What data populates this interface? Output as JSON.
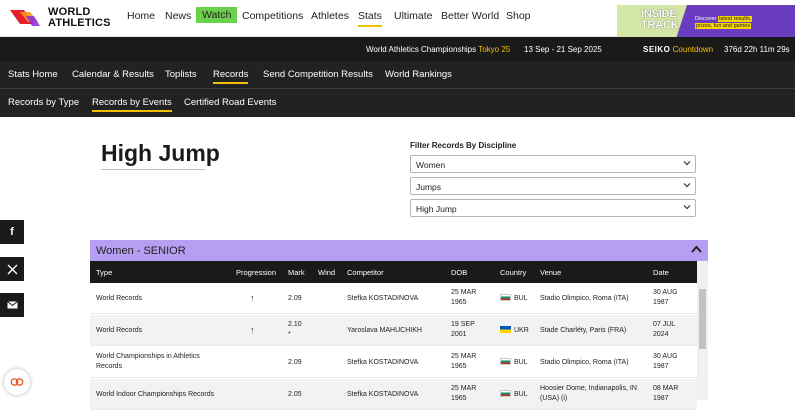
{
  "brand": {
    "name_line1": "WORLD",
    "name_line2": "ATHLETICS"
  },
  "topnav": {
    "items": [
      {
        "label": "Home"
      },
      {
        "label": "News"
      },
      {
        "label": "Watch"
      },
      {
        "label": "Competitions"
      },
      {
        "label": "Athletes"
      },
      {
        "label": "Stats"
      },
      {
        "label": "Ultimate"
      },
      {
        "label": "Better World"
      },
      {
        "label": "Shop"
      }
    ],
    "active": "Stats"
  },
  "promo": {
    "title_line1": "INSIDE",
    "title_line2": "TRACK",
    "text_prefix": "Discover",
    "text_highlight1": "latest results,",
    "text_highlight2": "prizes, fun and games"
  },
  "champbar": {
    "event": "World Athletics Championships",
    "city": "Tokyo 25",
    "dates": "13 Sep - 21 Sep 2025",
    "sponsor": "SEIKO",
    "countdown_label": "Countdown",
    "countdown": "376d 22h 11m 29s"
  },
  "statsnav": {
    "items": [
      {
        "label": "Stats Home"
      },
      {
        "label": "Calendar & Results"
      },
      {
        "label": "Toplists"
      },
      {
        "label": "Records"
      },
      {
        "label": "Send Competition Results"
      },
      {
        "label": "World Rankings"
      }
    ],
    "active": "Records"
  },
  "subnav": {
    "items": [
      {
        "label": "Records by Type"
      },
      {
        "label": "Records by Events"
      },
      {
        "label": "Certified Road Events"
      }
    ],
    "active": "Records by Events"
  },
  "page": {
    "title": "High Jump"
  },
  "filter": {
    "label": "Filter Records By Discipline",
    "gender": "Women",
    "group": "Jumps",
    "event": "High Jump"
  },
  "table": {
    "heading": "Women - SENIOR",
    "columns": [
      "Type",
      "Progression",
      "Mark",
      "Wind",
      "Competitor",
      "DOB",
      "Country",
      "Venue",
      "Date"
    ],
    "rows": [
      {
        "type": "World Records",
        "progression": "↑",
        "mark": "2.09",
        "mark2": "",
        "wind": "",
        "competitor": "Stefka KOSTADINOVA",
        "dob1": "25 MAR",
        "dob2": "1965",
        "country": "BUL",
        "venue1": "Stadio Olimpico, Roma (ITA)",
        "venue2": "",
        "date1": "30 AUG",
        "date2": "1987"
      },
      {
        "type": "World Records",
        "progression": "↑",
        "mark": "2.10",
        "mark2": "*",
        "wind": "",
        "competitor": "Yaroslava MAHUCHIKH",
        "dob1": "19 SEP",
        "dob2": "2001",
        "country": "UKR",
        "venue1": "Stade Charléty, Paris (FRA)",
        "venue2": "",
        "date1": "07 JUL",
        "date2": "2024"
      },
      {
        "type": "World Championships in Athletics",
        "type2": "Records",
        "progression": "",
        "mark": "2.09",
        "mark2": "",
        "wind": "",
        "competitor": "Stefka KOSTADINOVA",
        "dob1": "25 MAR",
        "dob2": "1965",
        "country": "BUL",
        "venue1": "Stadio Olimpico, Roma (ITA)",
        "venue2": "",
        "date1": "30 AUG",
        "date2": "1987"
      },
      {
        "type": "World Indoor Championships Records",
        "progression": "",
        "mark": "2.05",
        "mark2": "",
        "wind": "",
        "competitor": "Stefka KOSTADINOVA",
        "dob1": "25 MAR",
        "dob2": "1965",
        "country": "BUL",
        "venue1": "Hoosier Dome, Indianapolis, IN",
        "venue2": "(USA) (i)",
        "date1": "08 MAR",
        "date2": "1987"
      }
    ]
  },
  "colors": {
    "accent": "#f3c000",
    "table_header": "#b69ef2",
    "watch": "#6bd14c"
  }
}
